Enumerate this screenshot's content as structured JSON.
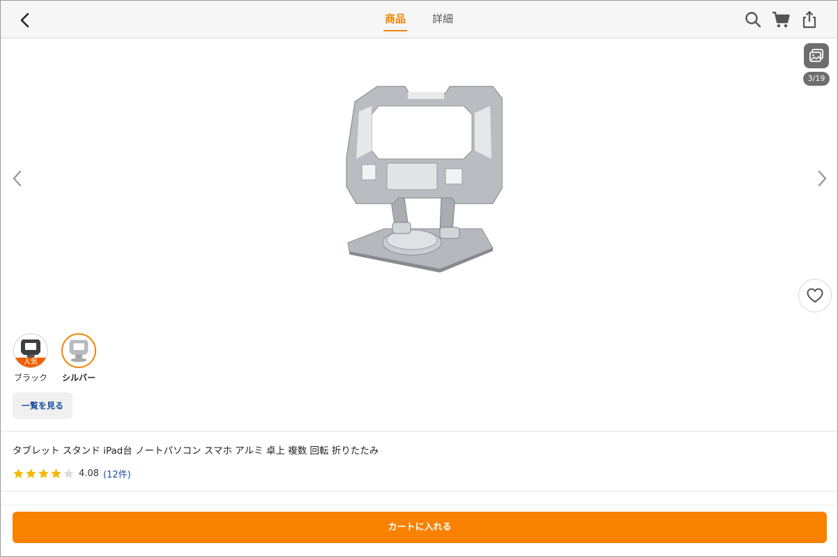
{
  "header": {
    "tabs": [
      {
        "label": "商品",
        "active": true
      },
      {
        "label": "詳細",
        "active": false
      }
    ],
    "icons": [
      "back-icon",
      "search-icon",
      "cart-icon",
      "share-icon"
    ]
  },
  "gallery": {
    "counter": "3/19"
  },
  "variants": [
    {
      "label": "ブラック",
      "badge": "人気",
      "selected": false
    },
    {
      "label": "シルバー",
      "badge": "",
      "selected": true
    }
  ],
  "view_all_label": "一覧を見る",
  "product": {
    "title": "タブレット スタンド iPad台 ノートパソコン スマホ アルミ 卓上 複数 回転 折りたたみ",
    "rating": {
      "score": "4.08",
      "reviews": "(12件)",
      "stars_filled": 4,
      "stars_total": 5
    }
  },
  "cart_button": "カートに入れる",
  "colors": {
    "accent": "#f08300",
    "cart": "#f88200",
    "star": "#f5b800",
    "link": "#1a4fa0",
    "badge": "#f06000"
  }
}
